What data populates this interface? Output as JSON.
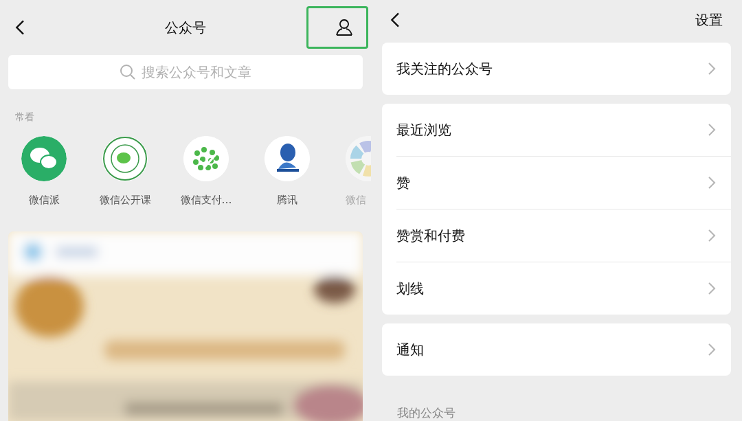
{
  "left_screen": {
    "title": "公众号",
    "profile_button": {
      "highlighted": true
    },
    "search": {
      "placeholder": "搜索公众号和文章"
    },
    "section_label": "常看",
    "accounts": [
      {
        "name": "微信派",
        "kind": "chat",
        "faded": false
      },
      {
        "name": "微信公开课",
        "kind": "seal",
        "faded": false
      },
      {
        "name": "微信支付…",
        "kind": "pattern",
        "faded": false
      },
      {
        "name": "腾讯",
        "kind": "penguin",
        "faded": false
      },
      {
        "name": "微信",
        "kind": "wheel",
        "faded": true
      }
    ]
  },
  "right_screen": {
    "action": "设置",
    "groups": [
      {
        "rows": [
          "我关注的公众号"
        ]
      },
      {
        "rows": [
          "最近浏览",
          "赞",
          "赞赏和付费",
          "划线"
        ]
      },
      {
        "rows": [
          "通知"
        ]
      }
    ],
    "section_heading": "我的公众号"
  }
}
